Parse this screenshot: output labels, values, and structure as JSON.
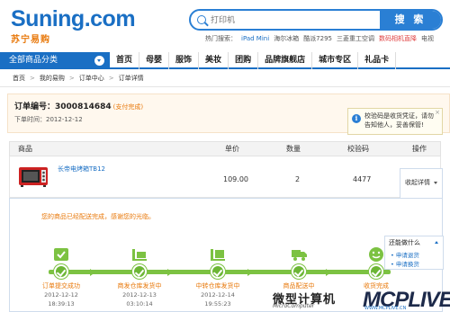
{
  "header": {
    "logo_text": "Suning.com",
    "logo_sub": "苏宁易购",
    "search_placeholder": "打印机",
    "search_button": "搜 索",
    "hot_label": "热门搜索：",
    "hot_words": [
      "iPad Mini",
      "海尔冰箱",
      "酷派7295",
      "三菱重工空调",
      "数码相机直降",
      "电视"
    ]
  },
  "nav": {
    "all_categories": "全部商品分类",
    "items": [
      "首页",
      "母婴",
      "服饰",
      "美妆",
      "团购",
      "品牌旗舰店",
      "城市专区",
      "礼品卡"
    ]
  },
  "breadcrumb": [
    "首页",
    "我的易购",
    "订单中心",
    "订单详情"
  ],
  "order": {
    "number_label": "订单编号：",
    "number": "3000814684",
    "status": "(支付完成)",
    "time_label": "下单时间：",
    "time": "2012-12-12"
  },
  "tip": {
    "text_line1": "校验码是收货凭证，请勿",
    "text_line2": "告知他人，妥善保管!",
    "close": "×"
  },
  "table": {
    "headers": [
      "商品",
      "单价",
      "数量",
      "校验码",
      "操作"
    ],
    "row": {
      "name": "长帝电烤箱TB12",
      "price": "109.00",
      "qty": "2",
      "code": "4477",
      "action": "收起详情"
    }
  },
  "progress": {
    "message": "您的商品已经配送完成，感谢您的光临。",
    "menu_title": "还能做什么",
    "menu_items": [
      "申请退货",
      "申请换货"
    ],
    "steps": [
      {
        "label": "订单提交成功",
        "date": "2012-12-12",
        "time": "18:39:13"
      },
      {
        "label": "商发仓库发货中",
        "date": "2012-12-13",
        "time": "03:10:14"
      },
      {
        "label": "中转仓库发货中",
        "date": "2012-12-14",
        "time": "19:55:23"
      },
      {
        "label": "商品配送中",
        "date": "",
        "time": ""
      },
      {
        "label": "收货完成",
        "date": "",
        "time": ""
      }
    ],
    "completion": 1.0
  },
  "watermark": {
    "cn": "微型计算机",
    "en": "MicroComputer",
    "brand": "MCPLIVE",
    "url": "WWW.MCPLIVE.CN"
  },
  "colors": {
    "brand_blue": "#1a6fc4",
    "accent_orange": "#e8780a",
    "progress_green": "#7cc242"
  }
}
